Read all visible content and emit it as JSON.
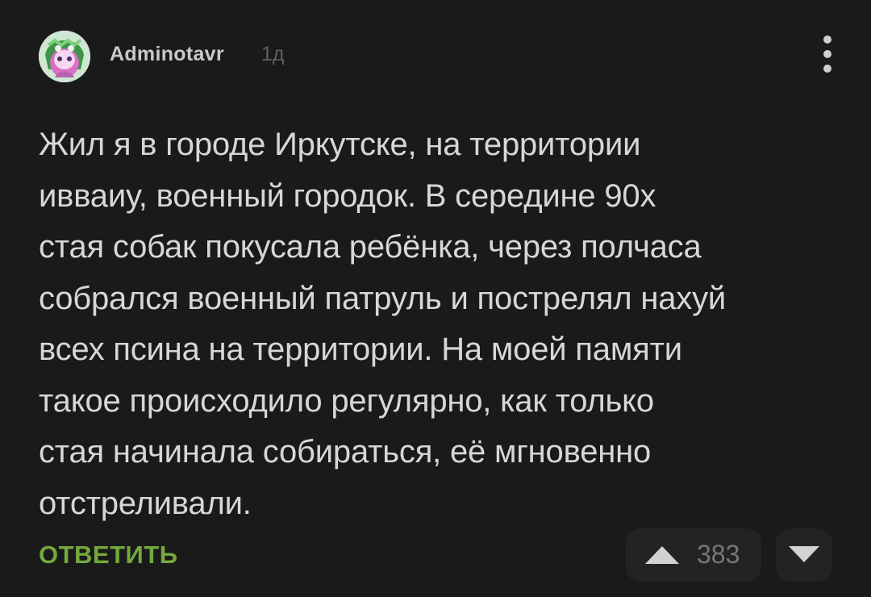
{
  "comment": {
    "author": "Adminotavr",
    "time_ago": "1д",
    "text": "Жил я в городе Иркутске, на территории\nивваиу, военный городок. В середине 90х\nстая собак покусала ребёнка, через полчаса\nсобрался военный патруль и пострелял нахуй\nвсех псина на территории. На моей памяти\nтакое происходило регулярно, как только\nстая начинала собираться, её мгновенно\nотстреливали.",
    "reply_label": "ОТВЕТИТЬ",
    "rating": "383"
  },
  "icons": {
    "avatar": "avatar-image",
    "menu": "more-vertical-icon",
    "upvote": "upvote-arrow-icon",
    "downvote": "downvote-arrow-icon"
  },
  "colors": {
    "background": "#1a1a1a",
    "text": "#d7d7d7",
    "reply": "#74a83d",
    "vote_panel": "#232323",
    "muted": "#777777"
  }
}
